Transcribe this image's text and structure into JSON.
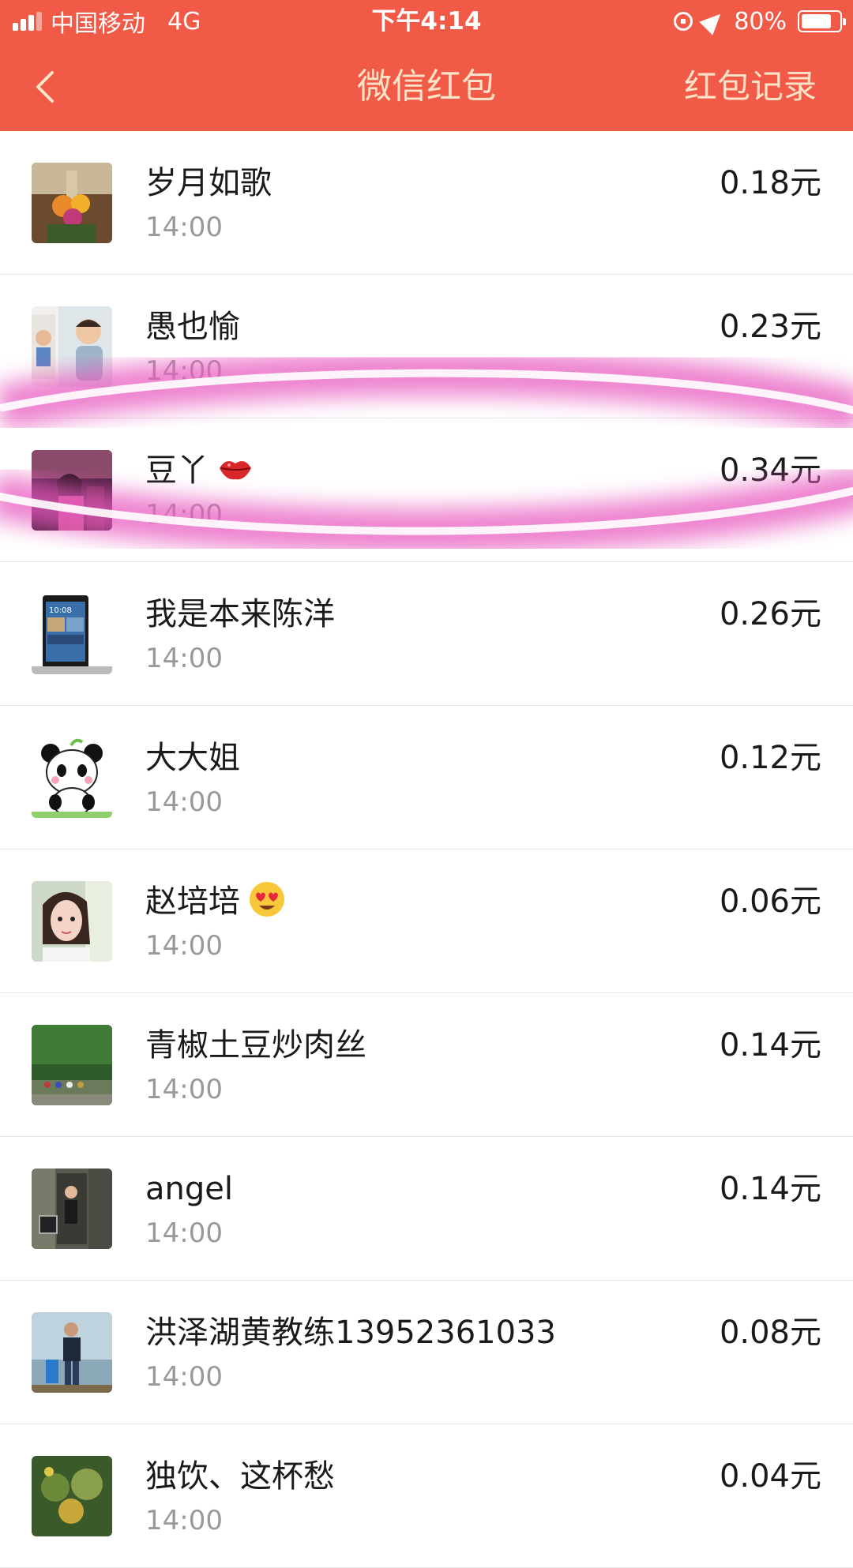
{
  "status_bar": {
    "carrier": "中国移动",
    "network": "4G",
    "time": "下午4:14",
    "battery": "80%",
    "battery_level": 0.8
  },
  "nav": {
    "title": "微信红包",
    "right_label": "红包记录"
  },
  "colors": {
    "header_bg": "#F15A47",
    "header_text": "#FCE3C8",
    "highlight": "#E85ABF"
  },
  "records": [
    {
      "name": "岁月如歌",
      "time": "14:00",
      "amount": "0.18元",
      "avatar": "flowers-photo-avatar"
    },
    {
      "name": "愚也愉",
      "time": "14:00",
      "amount": "0.23元",
      "avatar": "child-photo-avatar"
    },
    {
      "name": "豆丫",
      "emoji": "kiss-lips-emoji",
      "time": "14:00",
      "amount": "0.34元",
      "avatar": "girl-photo-avatar"
    },
    {
      "name": "我是本来陈洋",
      "time": "14:00",
      "amount": "0.26元",
      "avatar": "phone-photo-avatar"
    },
    {
      "name": "大大姐",
      "time": "14:00",
      "amount": "0.12元",
      "avatar": "panda-cartoon-avatar"
    },
    {
      "name": "赵培培",
      "emoji": "heart-eyes-emoji",
      "time": "14:00",
      "amount": "0.06元",
      "avatar": "woman-selfie-avatar"
    },
    {
      "name": "青椒土豆炒肉丝",
      "time": "14:00",
      "amount": "0.14元",
      "avatar": "forest-cyclists-avatar"
    },
    {
      "name": "angel",
      "time": "14:00",
      "amount": "0.14元",
      "avatar": "man-gate-avatar"
    },
    {
      "name": "洪泽湖黄教练13952361033",
      "time": "14:00",
      "amount": "0.08元",
      "avatar": "man-lake-avatar"
    },
    {
      "name": "独饮、这杯愁",
      "time": "14:00",
      "amount": "0.04元",
      "avatar": "plants-photo-avatar"
    }
  ]
}
